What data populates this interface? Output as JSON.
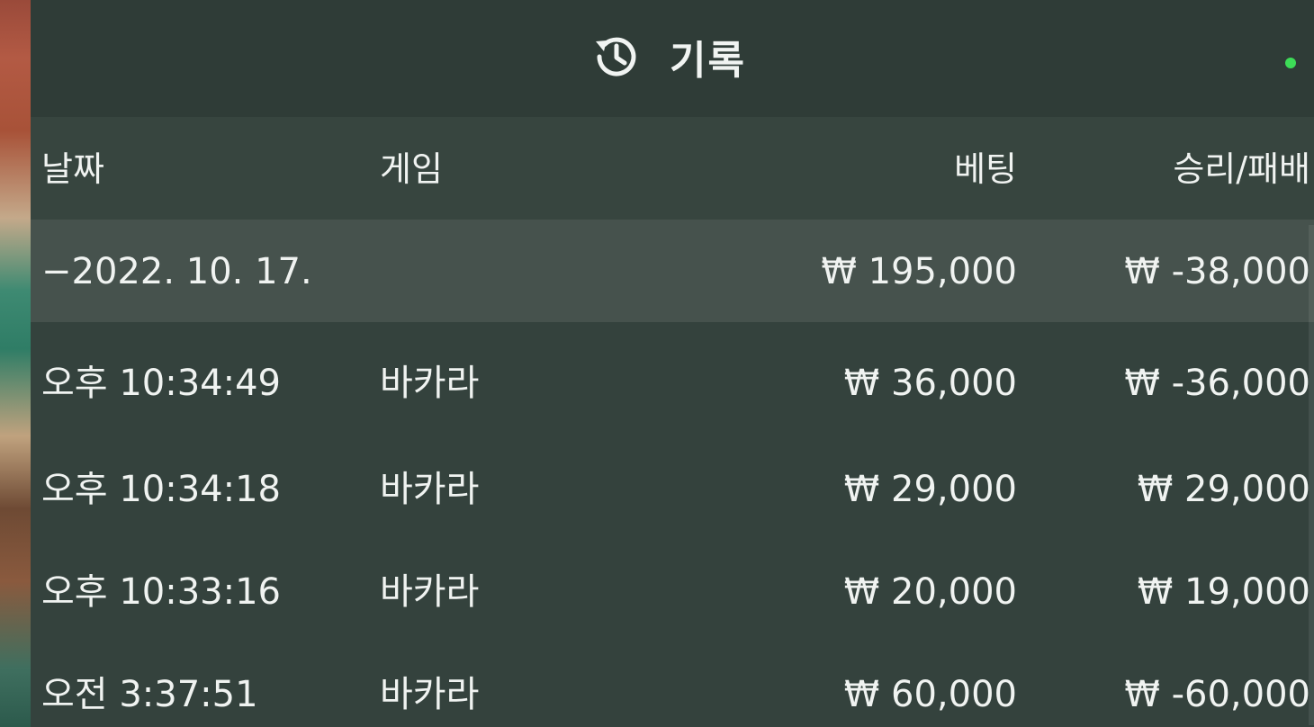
{
  "header": {
    "title": "기록",
    "icon": "history-icon",
    "status_color": "#3ddc57"
  },
  "columns": {
    "date": "날짜",
    "game": "게임",
    "bet": "베팅",
    "win_loss": "승리/패배"
  },
  "summary": {
    "date": "−2022. 10. 17.",
    "bet": "₩ 195,000",
    "win_loss": "₩ -38,000"
  },
  "rows": [
    {
      "time": "오후 10:34:49",
      "game": "바카라",
      "bet": "₩ 36,000",
      "win_loss": "₩ -36,000"
    },
    {
      "time": "오후 10:34:18",
      "game": "바카라",
      "bet": "₩ 29,000",
      "win_loss": "₩ 29,000"
    },
    {
      "time": "오후 10:33:16",
      "game": "바카라",
      "bet": "₩ 20,000",
      "win_loss": "₩ 19,000"
    },
    {
      "time": "오전 3:37:51",
      "game": "바카라",
      "bet": "₩ 60,000",
      "win_loss": "₩ -60,000"
    }
  ],
  "colors": {
    "panel": "#34423d",
    "header": "#2f3c37",
    "summary_row": "#46524d",
    "text": "#eef2f0"
  }
}
